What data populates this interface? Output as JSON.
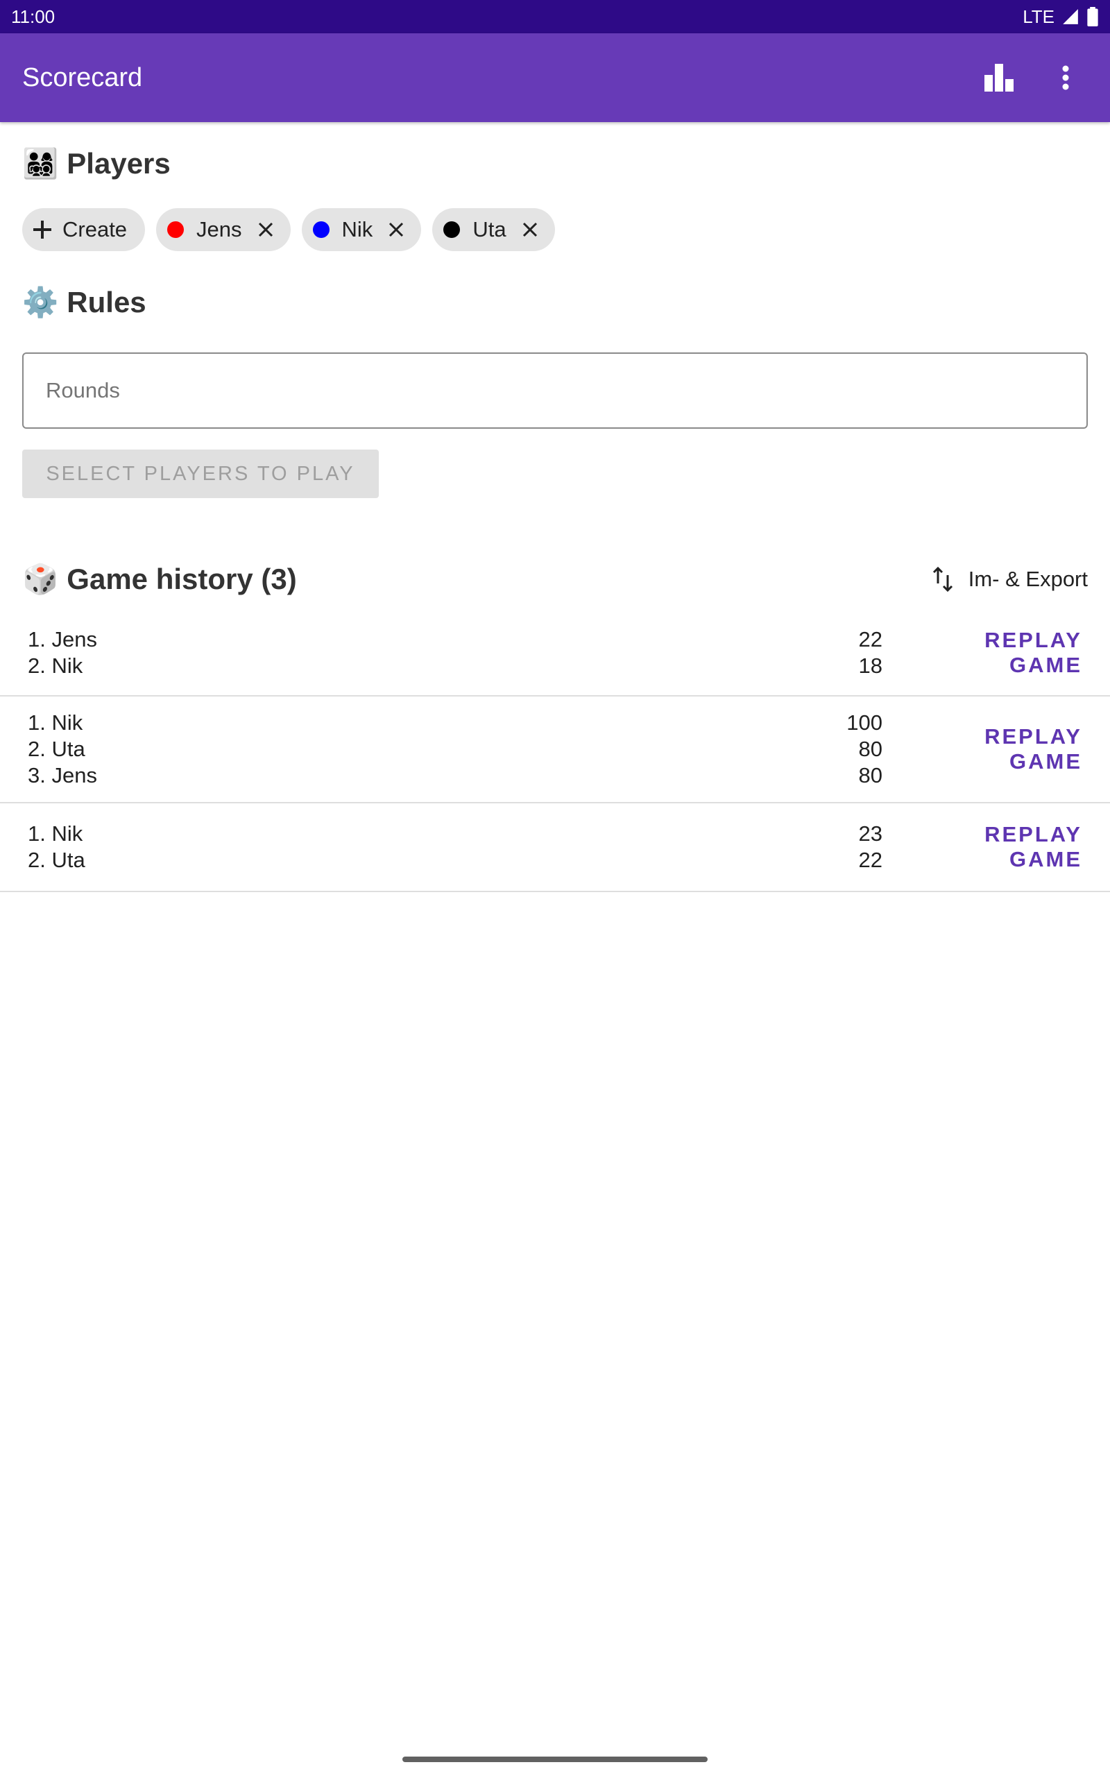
{
  "status_bar": {
    "time": "11:00",
    "network": "LTE",
    "signal_icon": "signal-icon",
    "battery_icon": "battery-icon"
  },
  "app_bar": {
    "title": "Scorecard",
    "stats_icon": "bar-chart-icon",
    "menu_icon": "more-vert-icon"
  },
  "players_section": {
    "emoji": "👨‍👩‍👧‍👦",
    "title": "Players",
    "create_label": "Create",
    "players": [
      {
        "name": "Jens",
        "color": "#ff0000"
      },
      {
        "name": "Nik",
        "color": "#0000ff"
      },
      {
        "name": "Uta",
        "color": "#000000"
      }
    ]
  },
  "rules_section": {
    "emoji": "⚙️",
    "title": "Rules",
    "rounds_placeholder": "Rounds",
    "rounds_value": "",
    "select_button_label": "SELECT PLAYERS TO PLAY"
  },
  "history_section": {
    "emoji": "🎲",
    "title": "Game history (3)",
    "export_label": "Im- & Export",
    "export_icon": "swap-vert-icon",
    "games": [
      {
        "results": [
          {
            "rank": "1. Jens",
            "score": "22"
          },
          {
            "rank": "2. Nik",
            "score": "18"
          }
        ],
        "replay_label": "REPLAY GAME"
      },
      {
        "results": [
          {
            "rank": "1. Nik",
            "score": "100"
          },
          {
            "rank": "2. Uta",
            "score": "80"
          },
          {
            "rank": "3. Jens",
            "score": "80"
          }
        ],
        "replay_label": "REPLAY GAME"
      },
      {
        "results": [
          {
            "rank": "1. Nik",
            "score": "23"
          },
          {
            "rank": "2. Uta",
            "score": "22"
          }
        ],
        "replay_label": "REPLAY GAME"
      }
    ]
  },
  "colors": {
    "status_bar": "#2e0a87",
    "app_bar": "#673ab7",
    "accent": "#5e35b1"
  }
}
